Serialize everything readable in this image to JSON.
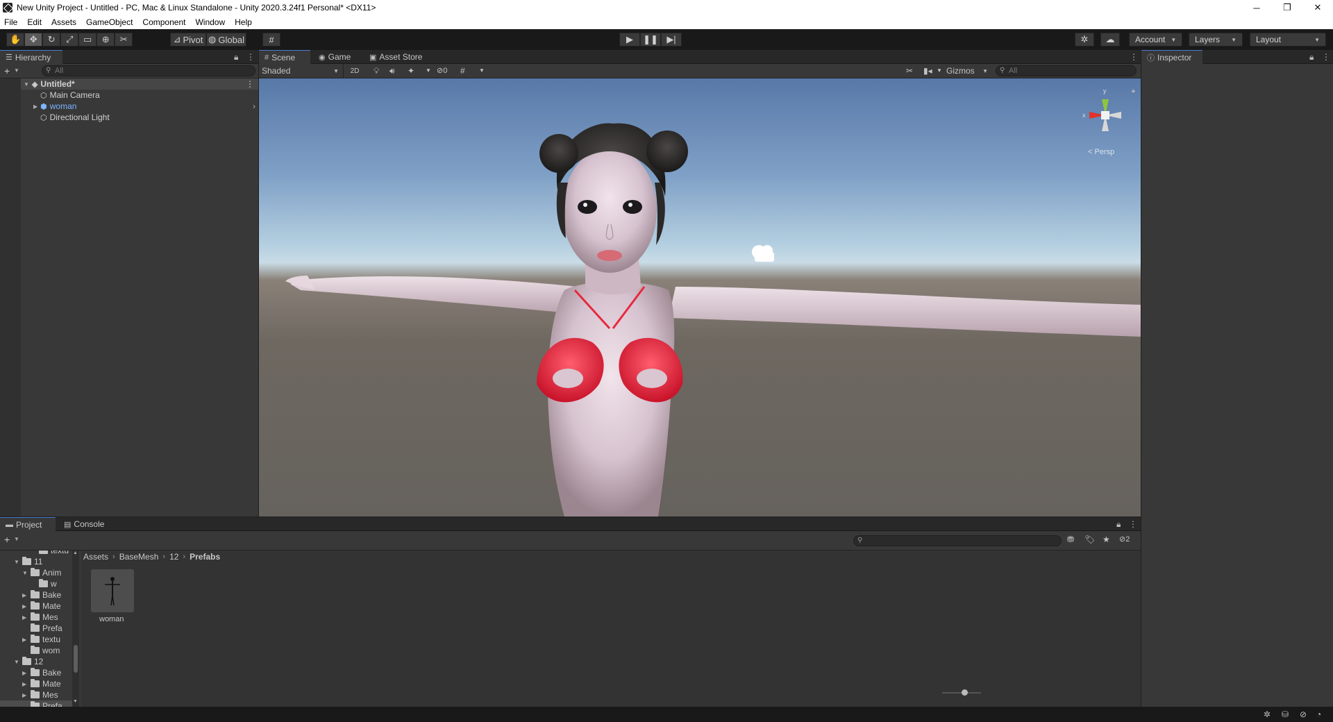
{
  "window": {
    "title": "New Unity Project - Untitled - PC, Mac & Linux Standalone - Unity 2020.3.24f1 Personal* <DX11>",
    "minimize": "─",
    "maximize": "❐",
    "close": "✕"
  },
  "menu": [
    "File",
    "Edit",
    "Assets",
    "GameObject",
    "Component",
    "Window",
    "Help"
  ],
  "toolbar": {
    "pivot": "Pivot",
    "global": "Global",
    "account": "Account",
    "layers": "Layers",
    "layout": "Layout"
  },
  "hierarchy": {
    "tab": "Hierarchy",
    "search_placeholder": "All",
    "scene_name": "Untitled*",
    "items": [
      "Main Camera",
      "woman",
      "Directional Light"
    ]
  },
  "scene": {
    "tabs": [
      "Scene",
      "Game",
      "Asset Store"
    ],
    "draw_mode": "Shaded",
    "toggle_2d": "2D",
    "hidden_count": "0",
    "gizmos": "Gizmos",
    "search_placeholder": "All",
    "persp_label": "< Persp",
    "axis_x": "x",
    "axis_y": "y"
  },
  "inspector": {
    "tab": "Inspector"
  },
  "project": {
    "tabs": [
      "Project",
      "Console"
    ],
    "visible_count": "2",
    "breadcrumb": [
      "Assets",
      "BaseMesh",
      "12",
      "Prefabs"
    ],
    "tree": [
      {
        "label": "textu",
        "indent": 3,
        "arrow": "",
        "clip": true
      },
      {
        "label": "11",
        "indent": 1,
        "arrow": "▼"
      },
      {
        "label": "Anim",
        "indent": 2,
        "arrow": "▼",
        "open": true
      },
      {
        "label": "w",
        "indent": 3,
        "arrow": ""
      },
      {
        "label": "Bake",
        "indent": 2,
        "arrow": "▶"
      },
      {
        "label": "Mate",
        "indent": 2,
        "arrow": "▶"
      },
      {
        "label": "Mes",
        "indent": 2,
        "arrow": "▶"
      },
      {
        "label": "Prefa",
        "indent": 2,
        "arrow": ""
      },
      {
        "label": "textu",
        "indent": 2,
        "arrow": "▶"
      },
      {
        "label": "wom",
        "indent": 2,
        "arrow": ""
      },
      {
        "label": "12",
        "indent": 1,
        "arrow": "▼"
      },
      {
        "label": "Bake",
        "indent": 2,
        "arrow": "▶"
      },
      {
        "label": "Mate",
        "indent": 2,
        "arrow": "▶"
      },
      {
        "label": "Mes",
        "indent": 2,
        "arrow": "▶"
      },
      {
        "label": "Prefa",
        "indent": 2,
        "arrow": "",
        "selected": true
      }
    ],
    "asset_name": "woman"
  },
  "colors": {
    "accent": "#4a7bd0",
    "prefab_text": "#7cb4ff",
    "editor_bg": "#383838"
  }
}
